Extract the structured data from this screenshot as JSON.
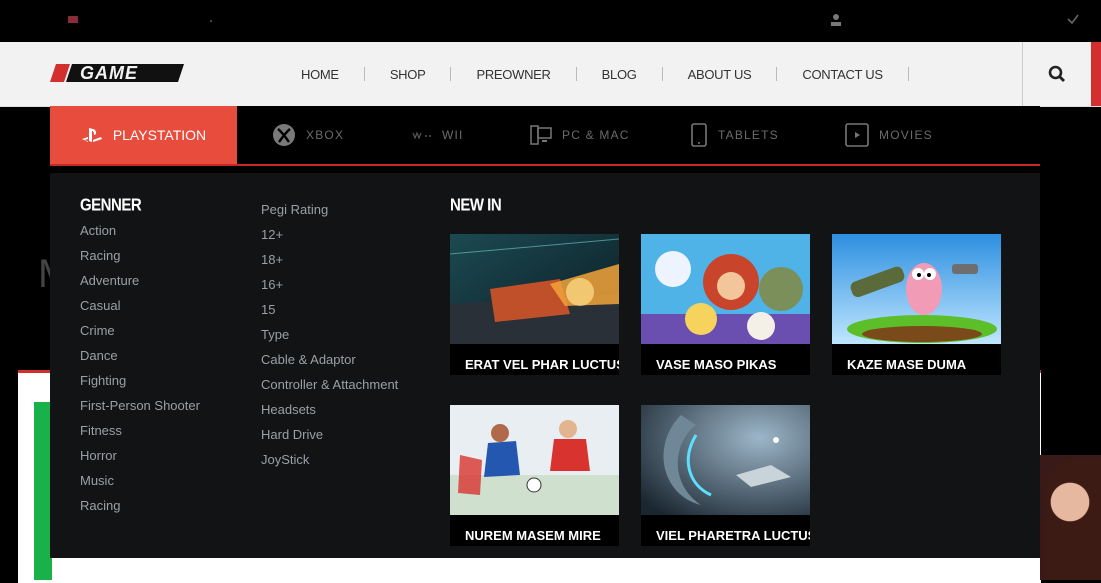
{
  "header": {
    "nav": [
      "HOME",
      "SHOP",
      "PREOWNER",
      "BLOG",
      "ABOUT US",
      "CONTACT US"
    ],
    "logo_text": "iGame"
  },
  "tabs": [
    {
      "label": "PLAYSTATION",
      "icon": "playstation-icon",
      "active": true
    },
    {
      "label": "XBOX",
      "icon": "xbox-icon"
    },
    {
      "label": "WII",
      "icon": "wii-icon"
    },
    {
      "label": "PC & MAC",
      "icon": "pc-mac-icon"
    },
    {
      "label": "TABLETS",
      "icon": "tablet-icon"
    },
    {
      "label": "MOVIES",
      "icon": "movie-icon"
    }
  ],
  "mega": {
    "genre_title": "GENNER",
    "genres": [
      "Action",
      "Racing",
      "Adventure",
      "Casual",
      "Crime",
      "Dance",
      "Fighting",
      "First-Person Shooter",
      "Fitness",
      "Horror",
      "Music",
      "Racing"
    ],
    "filters": [
      "Pegi Rating",
      "12+",
      "18+",
      "16+",
      "15",
      "Type",
      "Cable & Adaptor",
      "Controller & Attachment",
      "Headsets",
      "Hard Drive",
      "JoyStick"
    ],
    "new_in_title": "NEW IN",
    "products": [
      {
        "title": "ERAT VEL PHAR LUCTUS"
      },
      {
        "title": "VASE MASO PIKAS"
      },
      {
        "title": "KAZE MASE DUMA"
      },
      {
        "title": "NUREM MASEM MIRE"
      },
      {
        "title": "VIEL PHARETRA LUCTUS"
      }
    ]
  },
  "colors": {
    "accent": "#e74c3c",
    "menu_bg": "#121314",
    "header_bg": "#f2f2f2"
  }
}
